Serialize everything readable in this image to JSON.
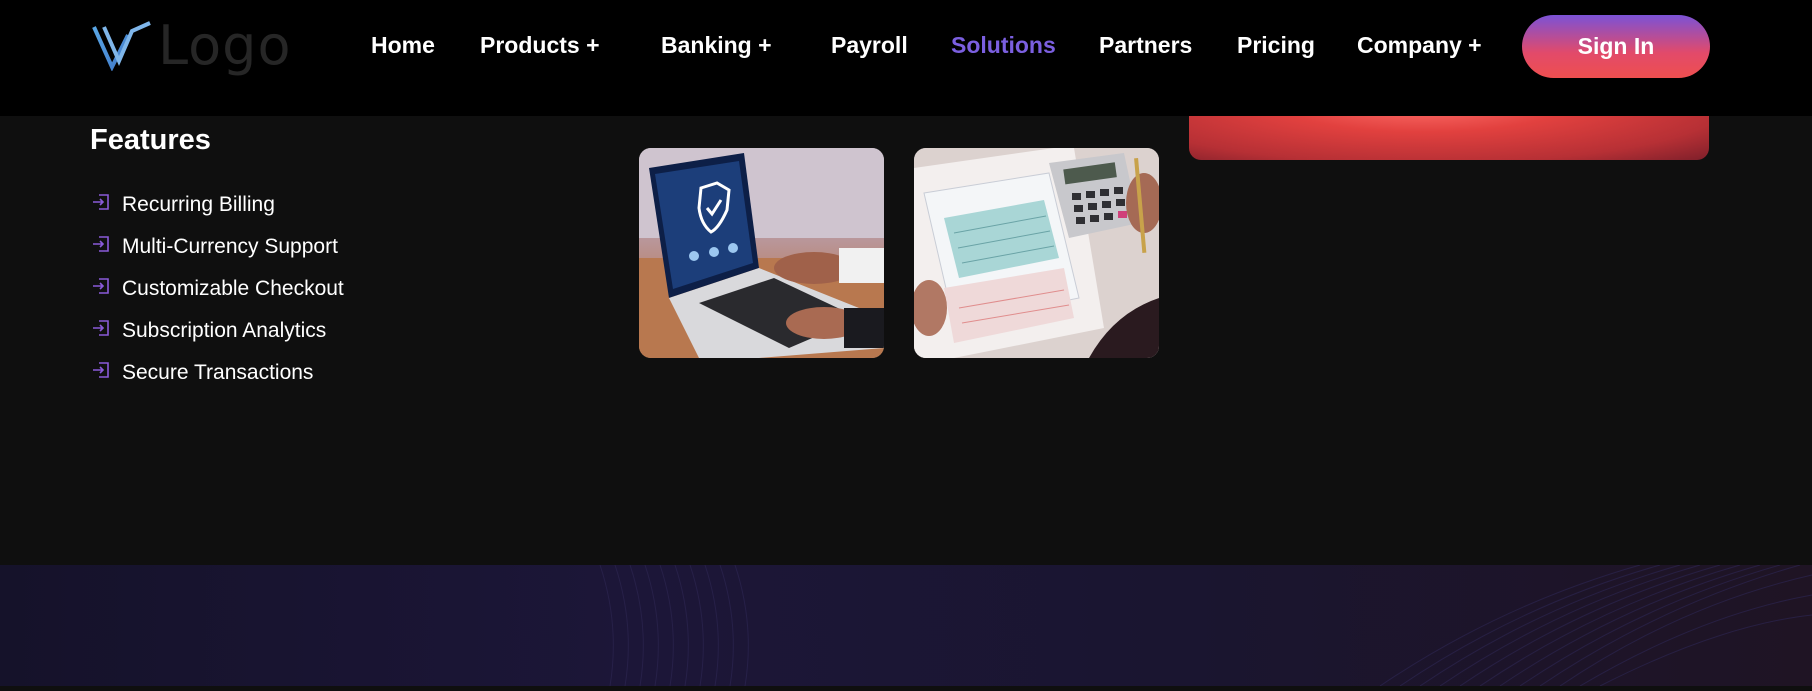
{
  "brand": {
    "logo_text": "Logo"
  },
  "nav": {
    "items": [
      {
        "label": "Home"
      },
      {
        "label": "Products +"
      },
      {
        "label": "Banking +"
      },
      {
        "label": "Payroll"
      },
      {
        "label": "Solutions",
        "active": true
      },
      {
        "label": "Partners"
      },
      {
        "label": "Pricing"
      },
      {
        "label": "Company +"
      }
    ],
    "signin_label": "Sign In",
    "active_color": "#7b5fe0"
  },
  "features": {
    "title": "Features",
    "items": [
      {
        "label": "Recurring Billing",
        "icon": "login-arrow-icon"
      },
      {
        "label": "Multi-Currency Support",
        "icon": "login-arrow-icon"
      },
      {
        "label": "Customizable Checkout",
        "icon": "login-arrow-icon"
      },
      {
        "label": "Subscription Analytics",
        "icon": "login-arrow-icon"
      },
      {
        "label": "Secure Transactions",
        "icon": "login-arrow-icon"
      }
    ]
  },
  "images": [
    {
      "subject": "laptop-security-shield"
    },
    {
      "subject": "invoice-calculator"
    }
  ]
}
